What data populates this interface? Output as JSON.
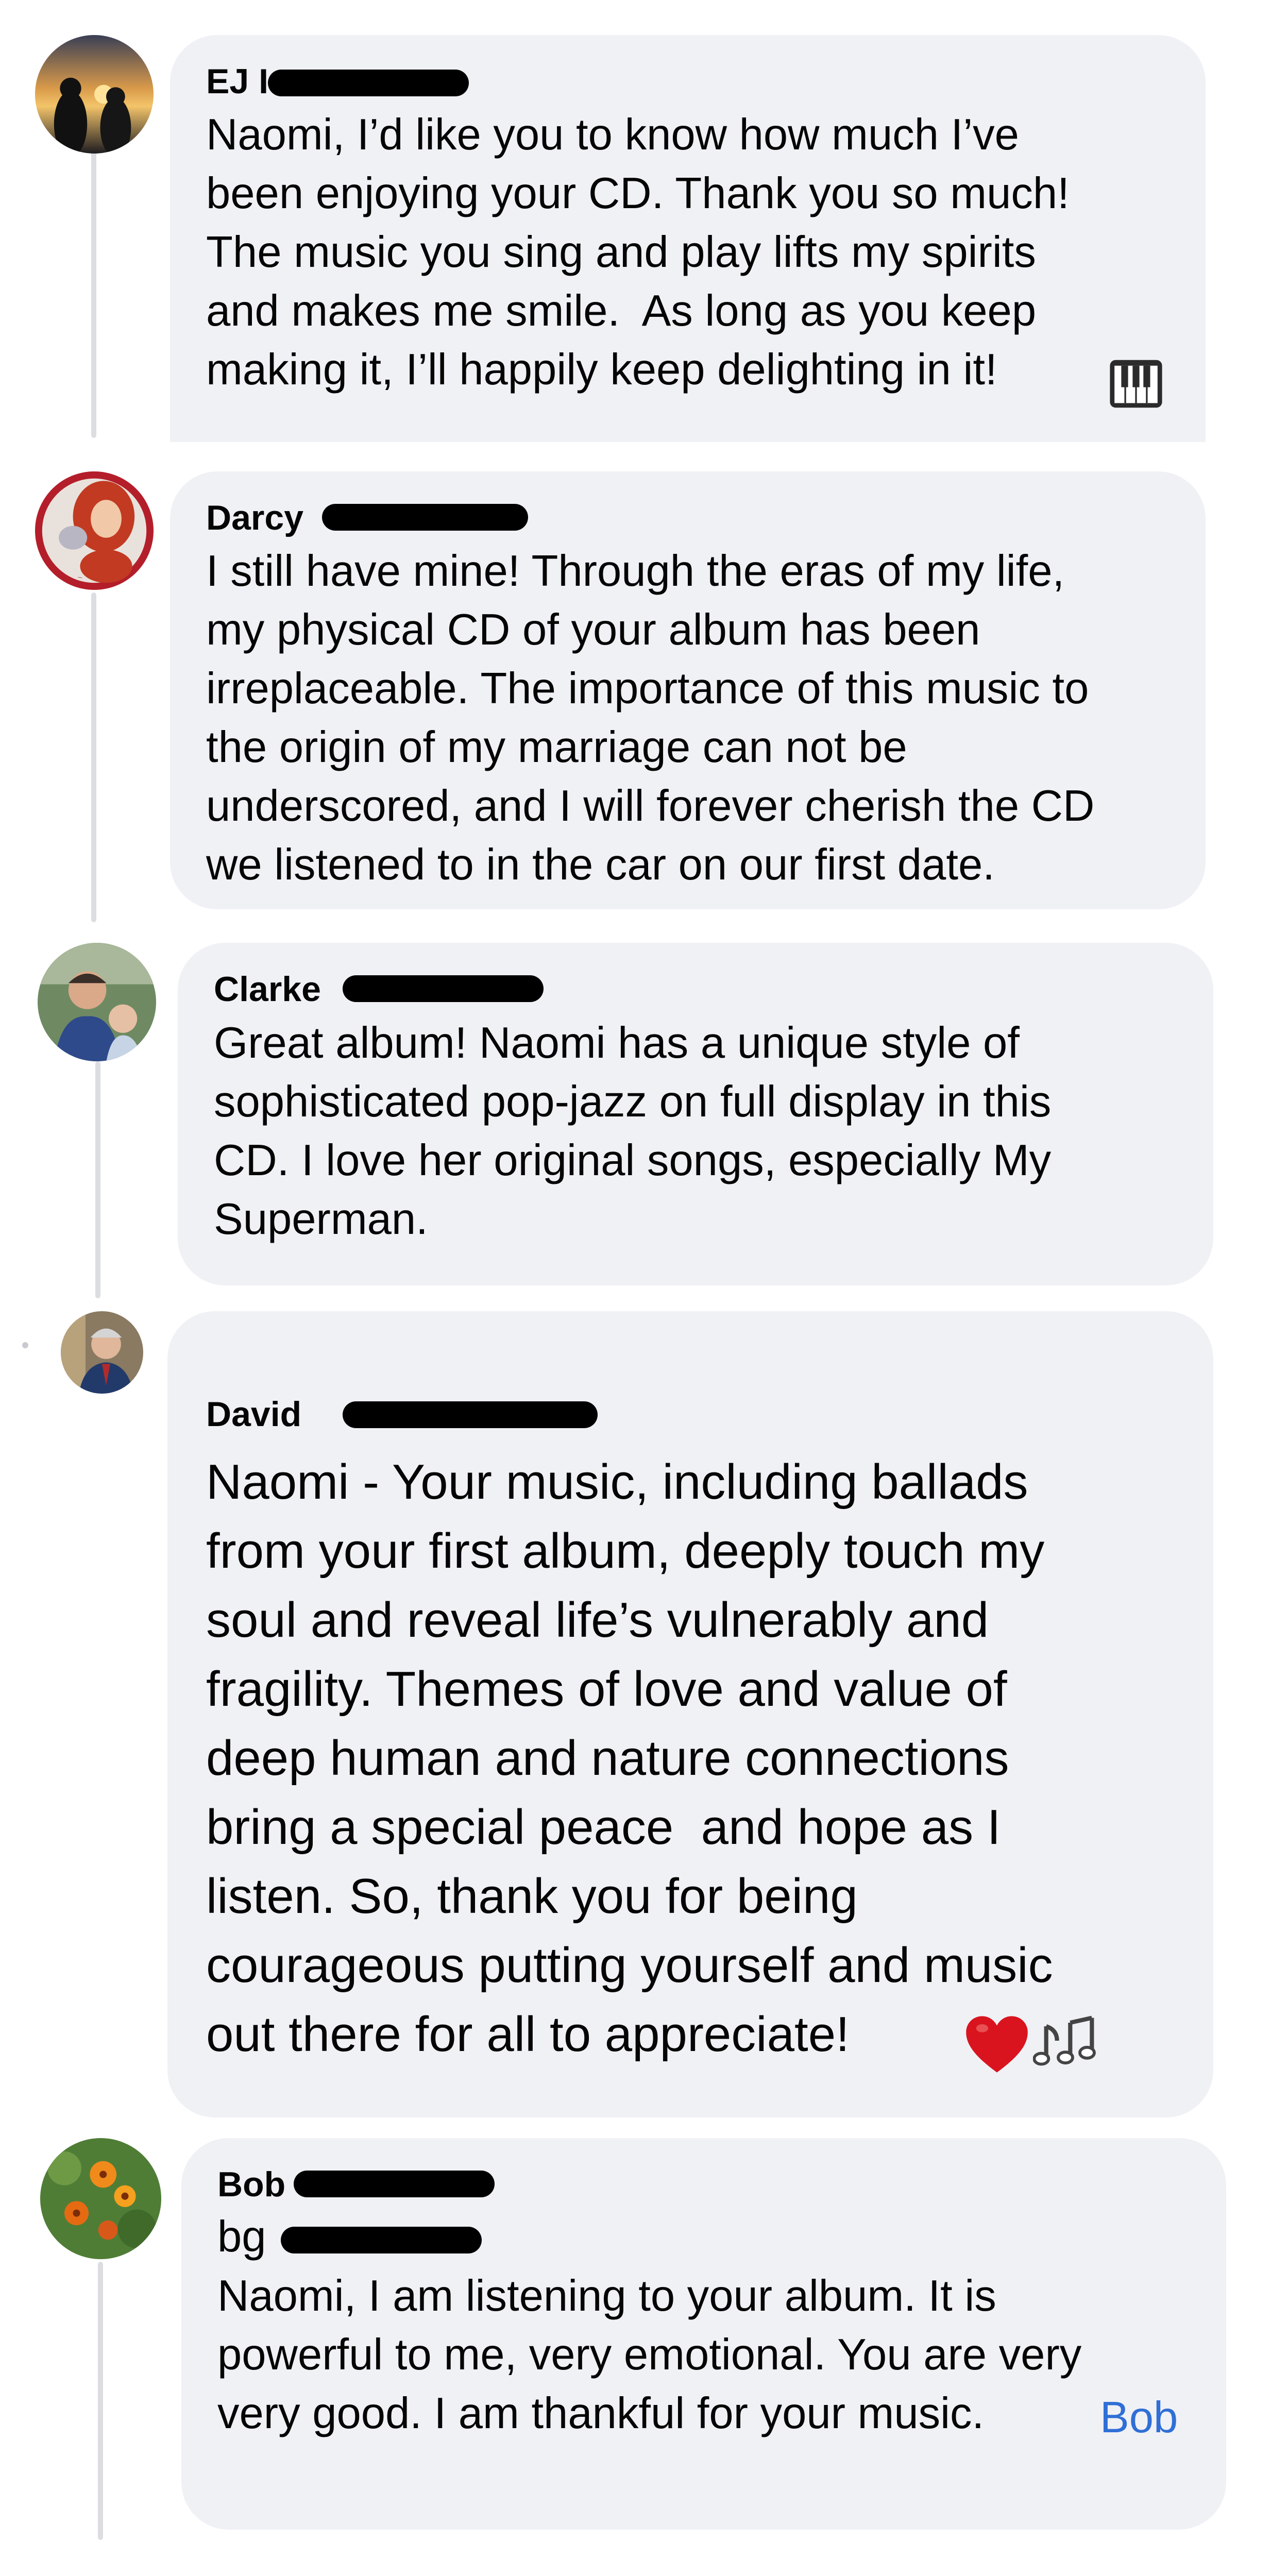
{
  "comments": [
    {
      "author": "EJ I",
      "text": "Naomi, I’d like you to know how much I’ve\nbeen enjoying your CD. Thank you so much!\nThe music you sing and play lifts my spirits\nand makes me smile.  As long as you keep\nmaking it, I’ll happily keep delighting in it!",
      "emoji_icon": "piano-keys-icon"
    },
    {
      "author": "Darcy",
      "text": "I still have mine! Through the eras of my life,\nmy physical CD of your album has been\nirreplaceable. The importance of this music to\nthe origin of my marriage can not be\nunderscored, and I will forever cherish the CD\nwe listened to in the car on our first date."
    },
    {
      "author": "Clarke",
      "text": "Great album! Naomi has a unique style of\nsophisticated pop-jazz on full display in this\nCD. I love her original songs, especially My\nSuperman."
    },
    {
      "author": "David",
      "text": "Naomi - Your music, including ballads\nfrom your first album, deeply touch my\nsoul and reveal life’s vulnerably and\nfragility. Themes of love and value of\ndeep human and nature connections\nbring a special peace  and hope as I\nlisten. So, thank you for being\ncourageous putting yourself and music\nout there for all to appreciate!",
      "emoji_icons": [
        "red-heart-icon",
        "music-notes-icon"
      ]
    },
    {
      "author": "Bob",
      "handle": "bg",
      "text": "Naomi, I am listening to your album. It is\npowerful to me, very emotional. You are very\nvery good. I am thankful for your music.",
      "signature": "Bob"
    }
  ],
  "colors": {
    "bubble": "#f0f1f5",
    "thread_line": "#dcdde1",
    "link": "#2f6fd6",
    "text": "#050505"
  }
}
